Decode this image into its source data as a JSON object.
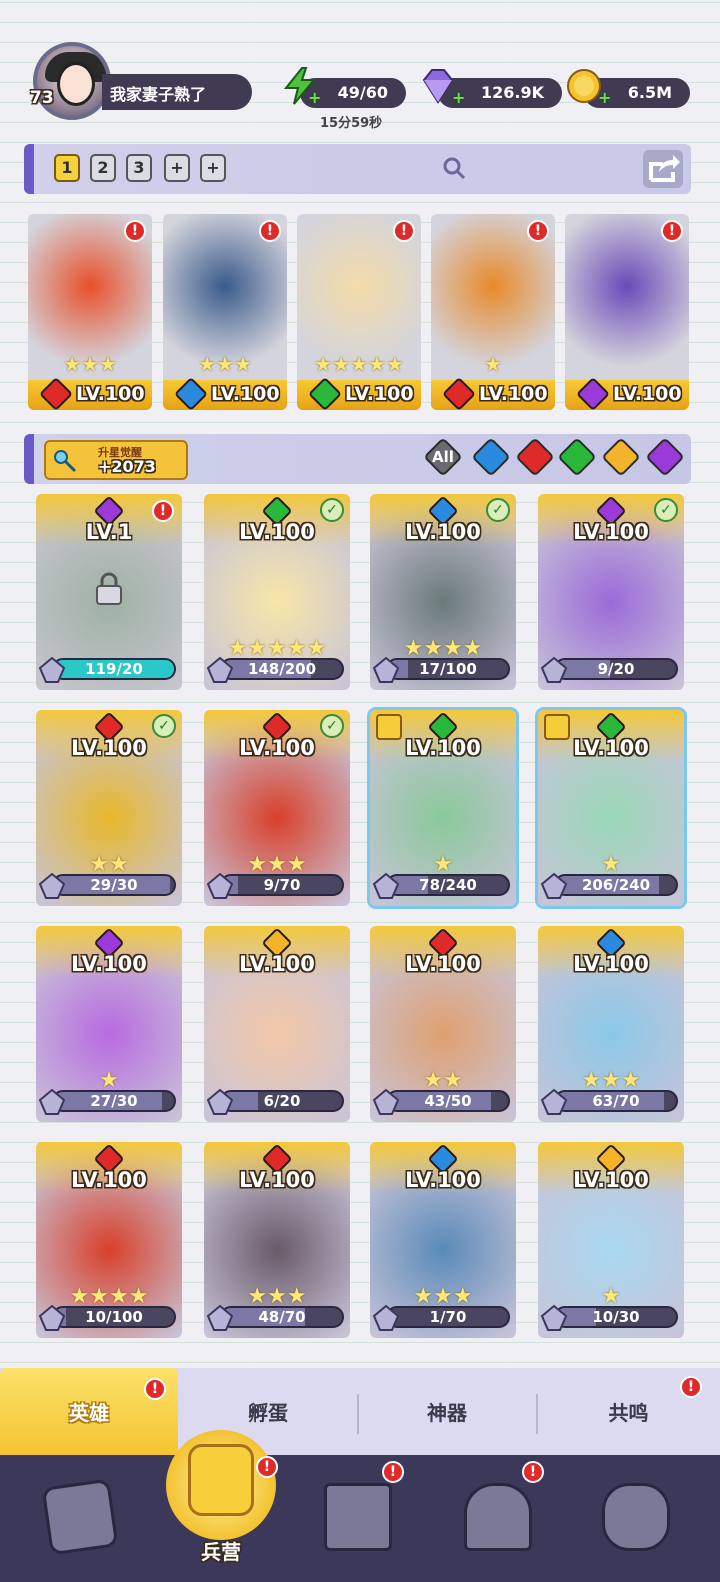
{
  "player": {
    "level": "73",
    "name": "我家妻子熟了"
  },
  "resources": {
    "energy": {
      "value": "49/60",
      "timer": "15分59秒",
      "icon": "lightning-icon",
      "color": "#4ec23a"
    },
    "gems": {
      "value": "126.9K",
      "icon": "diamond-icon",
      "color": "#8a6ae0"
    },
    "gold": {
      "value": "6.5M",
      "icon": "coin-icon",
      "color": "#f3c330"
    }
  },
  "team_tabs": [
    "1",
    "2",
    "3",
    "+",
    "+"
  ],
  "team": [
    {
      "level": "LV.100",
      "element": "fire",
      "stars": "★★★",
      "badge": "!",
      "color": "#e8502a"
    },
    {
      "level": "LV.100",
      "element": "water",
      "stars": "★★★",
      "badge": "!",
      "color": "#3a5a8a"
    },
    {
      "level": "LV.100",
      "element": "nature",
      "stars": "★★★★★",
      "badge": "!",
      "color": "#f4dca8"
    },
    {
      "level": "LV.100",
      "element": "fire",
      "stars": "★",
      "badge": "!",
      "color": "#e88a2a"
    },
    {
      "level": "LV.100",
      "element": "dark",
      "stars": "",
      "badge": "!",
      "color": "#6a4ab8"
    }
  ],
  "upgrade": {
    "title": "升星觉醒",
    "value": "+2073"
  },
  "filters": [
    {
      "label": "All",
      "element": "all",
      "color": "#6a6a72"
    },
    {
      "label": "",
      "element": "water",
      "color": "#2a8ae0"
    },
    {
      "label": "",
      "element": "fire",
      "color": "#e02a2a"
    },
    {
      "label": "",
      "element": "nature",
      "color": "#2ab83a"
    },
    {
      "label": "",
      "element": "light",
      "color": "#f3b42a"
    },
    {
      "label": "",
      "element": "dark",
      "color": "#9a3ad8"
    }
  ],
  "heroes": [
    {
      "level": "LV.1",
      "element": "dark",
      "progress": "119/20",
      "fill": 1.0,
      "stars": "",
      "status": "alert",
      "locked": true,
      "bg": "#8ab89a"
    },
    {
      "level": "LV.100",
      "element": "nature",
      "progress": "148/200",
      "fill": 0.74,
      "stars": "★★★★★",
      "status": "check",
      "locked": false,
      "bg": "#f7e6a8"
    },
    {
      "level": "LV.100",
      "element": "water",
      "progress": "17/100",
      "fill": 0.17,
      "stars": "★★★★",
      "status": "check",
      "locked": false,
      "bg": "#6a7a7a"
    },
    {
      "level": "LV.100",
      "element": "dark",
      "progress": "9/20",
      "fill": 0.45,
      "stars": "",
      "status": "check",
      "locked": false,
      "bg": "#9a6ad8"
    },
    {
      "level": "LV.100",
      "element": "fire",
      "progress": "29/30",
      "fill": 0.97,
      "stars": "★★",
      "status": "check",
      "locked": false,
      "bg": "#e8b82a"
    },
    {
      "level": "LV.100",
      "element": "fire",
      "progress": "9/70",
      "fill": 0.13,
      "stars": "★★★",
      "status": "check",
      "locked": false,
      "bg": "#d8402a"
    },
    {
      "level": "LV.100",
      "element": "nature",
      "progress": "78/240",
      "fill": 0.33,
      "stars": "★",
      "status": "tower",
      "locked": false,
      "bg": "#8ac89a"
    },
    {
      "level": "LV.100",
      "element": "nature",
      "progress": "206/240",
      "fill": 0.86,
      "stars": "★",
      "status": "tower",
      "locked": false,
      "bg": "#9ad8b8"
    },
    {
      "level": "LV.100",
      "element": "dark",
      "progress": "27/30",
      "fill": 0.9,
      "stars": "★",
      "status": "",
      "locked": false,
      "bg": "#b86ae0"
    },
    {
      "level": "LV.100",
      "element": "light",
      "progress": "6/20",
      "fill": 0.3,
      "stars": "",
      "status": "",
      "locked": false,
      "bg": "#f4c8a8"
    },
    {
      "level": "LV.100",
      "element": "fire",
      "progress": "43/50",
      "fill": 0.86,
      "stars": "★★",
      "status": "",
      "locked": false,
      "bg": "#e0a070"
    },
    {
      "level": "LV.100",
      "element": "water",
      "progress": "63/70",
      "fill": 0.9,
      "stars": "★★★",
      "status": "",
      "locked": false,
      "bg": "#8ac8e8"
    },
    {
      "level": "LV.100",
      "element": "fire",
      "progress": "10/100",
      "fill": 0.1,
      "stars": "★★★★",
      "status": "",
      "locked": false,
      "bg": "#d8402a"
    },
    {
      "level": "LV.100",
      "element": "fire",
      "progress": "48/70",
      "fill": 0.69,
      "stars": "★★★",
      "status": "",
      "locked": false,
      "bg": "#6a5a6a"
    },
    {
      "level": "LV.100",
      "element": "water",
      "progress": "1/70",
      "fill": 0.01,
      "stars": "★★★",
      "status": "",
      "locked": false,
      "bg": "#5a8ab8"
    },
    {
      "level": "LV.100",
      "element": "light",
      "progress": "10/30",
      "fill": 0.33,
      "stars": "★",
      "status": "",
      "locked": false,
      "bg": "#a8d8f0"
    }
  ],
  "tabs": [
    {
      "label": "英雄",
      "active": true,
      "badge": "!"
    },
    {
      "label": "孵蛋",
      "active": false,
      "badge": ""
    },
    {
      "label": "神器",
      "active": false,
      "badge": ""
    },
    {
      "label": "共鸣",
      "active": false,
      "badge": "!"
    }
  ],
  "nav": {
    "cards": {
      "icon": "cards-icon"
    },
    "barracks": {
      "label": "兵营",
      "icon": "barracks-icon",
      "badge": "!"
    },
    "map": {
      "icon": "map-icon",
      "badge": "!"
    },
    "shrine": {
      "icon": "shrine-icon",
      "badge": "!"
    },
    "guild": {
      "icon": "guild-icon"
    }
  }
}
